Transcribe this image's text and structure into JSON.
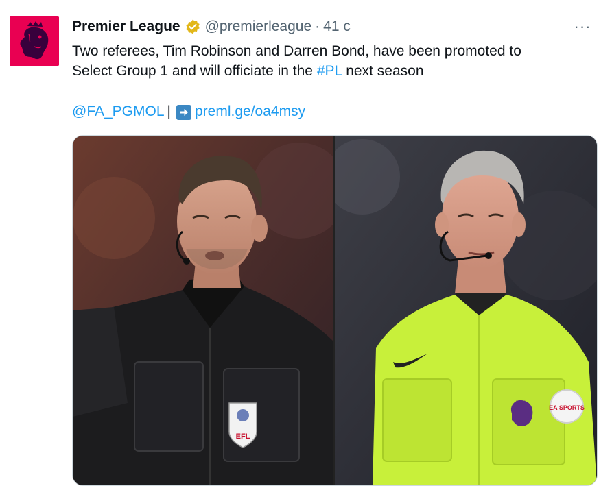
{
  "tweet": {
    "display_name": "Premier League",
    "handle": "@premierleague",
    "separator": "·",
    "timestamp": "41 с",
    "more_label": "···",
    "text_line1": "Two referees, Tim Robinson and Darren Bond, have been promoted to",
    "text_line2_before": "Select Group 1 and will officiate in the ",
    "hashtag": "#PL",
    "text_line2_after": " next season",
    "mention": "@FA_PGMOL",
    "pipe": "|",
    "url": "preml.ge/oa4msy"
  },
  "avatar": {
    "icon": "premier-league-lion-logo",
    "bg_color": "#e90052"
  },
  "badge": {
    "icon": "verified-gold-badge",
    "color": "#e2b719"
  },
  "colors": {
    "link": "#1d9bf0",
    "text": "#0f1419",
    "secondary": "#536471"
  },
  "media": {
    "left_photo": {
      "badge_text": "EFL",
      "shirt_color": "#1c1c1e"
    },
    "right_photo": {
      "badge_text": "EA SPORTS",
      "shirt_color": "#c8f03a"
    }
  }
}
